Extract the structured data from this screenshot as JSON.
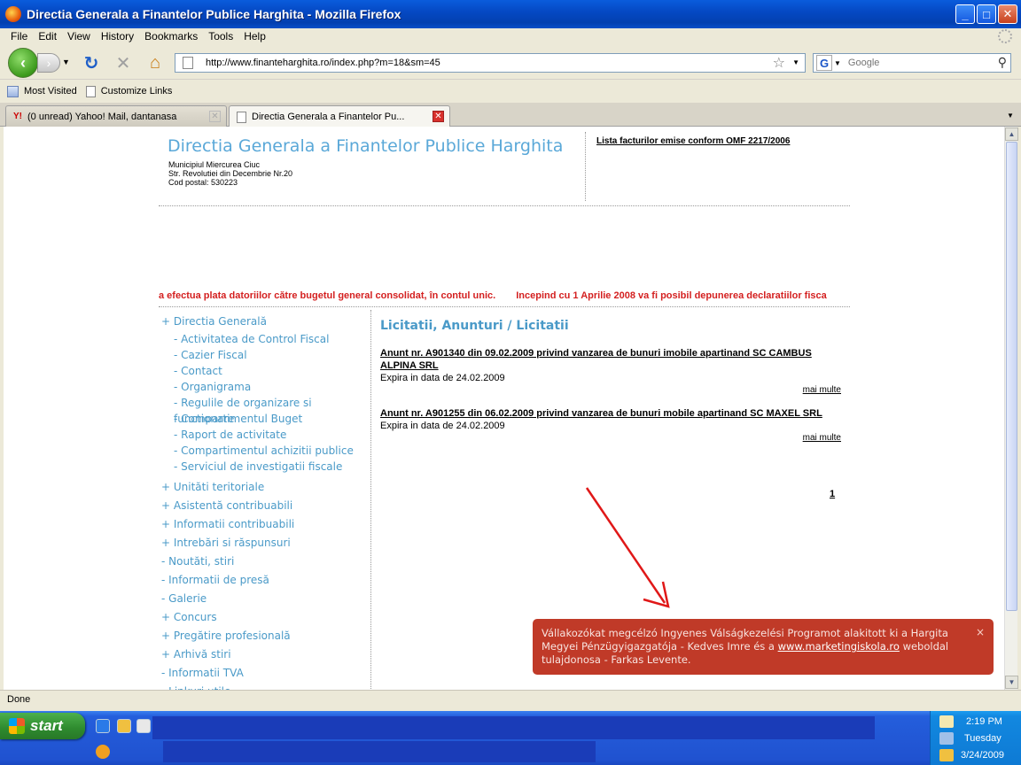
{
  "window": {
    "title": "Directia Generala a Finantelor Publice Harghita - Mozilla Firefox",
    "minimize": "_",
    "maximize": "□",
    "close": "✕"
  },
  "menu": [
    {
      "label": "File"
    },
    {
      "label": "Edit"
    },
    {
      "label": "View"
    },
    {
      "label": "History"
    },
    {
      "label": "Bookmarks"
    },
    {
      "label": "Tools"
    },
    {
      "label": "Help"
    }
  ],
  "nav": {
    "url": "http://www.finanteharghita.ro/index.php?m=18&sm=45",
    "search_placeholder": "Google"
  },
  "bookmarks": [
    {
      "label": "Most Visited"
    },
    {
      "label": "Customize Links"
    }
  ],
  "tabs": [
    {
      "label": "(0 unread) Yahoo! Mail, dantanasa",
      "active": false
    },
    {
      "label": "Directia Generala a Finantelor Pu...",
      "active": true
    }
  ],
  "page": {
    "site_title": "Directia Generala a Finantelor Publice Harghita",
    "address_lines": [
      "Municipiul Miercurea Ciuc",
      "Str. Revolutiei din Decembrie Nr.20",
      "Cod postal: 530223"
    ],
    "top_link": "Lista facturilor emise conform OMF 2217/2006",
    "marquee": [
      "a efectua plata datoriilor către bugetul general consolidat, în contul unic.",
      "Incepind cu 1 Aprilie 2008 va fi posibil depunerea declaratiilor fisca"
    ],
    "sidebar": {
      "top": "+ Directia Generală",
      "sub": [
        "- Activitatea de Control Fiscal",
        "- Cazier Fiscal",
        "- Contact",
        "- Organigrama",
        "- Regulile de organizare si functionare",
        "- Compartimentul Buget",
        "- Raport de activitate",
        "- Compartimentul achizitii publice",
        "- Serviciul de investigatii fiscale"
      ],
      "items": [
        "+ Unităti teritoriale",
        "+ Asistentă contribuabili",
        "+ Informatii contribuabili",
        "+ Intrebări si răspunsuri",
        "- Noutăti, stiri",
        "- Informatii de presă",
        "- Galerie",
        "+ Concurs",
        "+ Pregătire profesională",
        "+ Arhivă stiri",
        "- Informatii TVA",
        "- Linkuri utile"
      ]
    },
    "main": {
      "heading": "Licitatii, Anunturi / Licitatii",
      "announcements": [
        {
          "title": "Anunt nr. A901340 din 09.02.2009 privind vanzarea de bunuri imobile apartinand SC CAMBUS ALPINA SRL",
          "expires": "Expira in data de 24.02.2009",
          "more": "mai multe"
        },
        {
          "title": "Anunt nr. A901255 din 06.02.2009 privind vanzarea de bunuri mobile apartinand SC MAXEL SRL",
          "expires": "Expira in data de 24.02.2009",
          "more": "mai multe"
        }
      ],
      "pager": "1"
    },
    "toast": {
      "text_before": "Vállakozókat megcélzó Ingyenes Válságkezelési Programot alakitott ki a Hargita Megyei Pénzügyigazgatója - Kedves Imre és a ",
      "link": "www.marketingiskola.ro",
      "text_after": " weboldal tulajdonosa - Farkas Levente.",
      "close": "×"
    }
  },
  "status": "Done",
  "taskbar": {
    "start": "start",
    "time": "2:19 PM",
    "day": "Tuesday",
    "date": "3/24/2009"
  },
  "colors": {
    "site_blue": "#5aa8d8",
    "marquee_red": "#d42020",
    "toast_red": "#c03a28"
  }
}
